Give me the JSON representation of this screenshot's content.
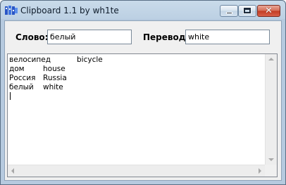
{
  "window": {
    "title": "Clipboard 1.1 by wh1te",
    "icon": "clipboard-app-icon",
    "buttons": {
      "minimize": "minimize-icon",
      "maximize": "maximize-icon",
      "close": "close-icon",
      "close_glyph": "✕"
    }
  },
  "form": {
    "word_label": "Слово:",
    "word_value": "белый",
    "translation_label": "Перевод:",
    "translation_value": "white"
  },
  "memo": {
    "lines": [
      {
        "word": "велосипед",
        "translation": "bicycle"
      },
      {
        "word": "дом",
        "translation": "house"
      },
      {
        "word": "Россия",
        "translation": "Russia"
      },
      {
        "word": "белый",
        "translation": "white"
      }
    ]
  },
  "colors": {
    "title_bar": "#c9dbea",
    "close_button": "#c23a22",
    "client_bg": "#f0f0f0"
  }
}
